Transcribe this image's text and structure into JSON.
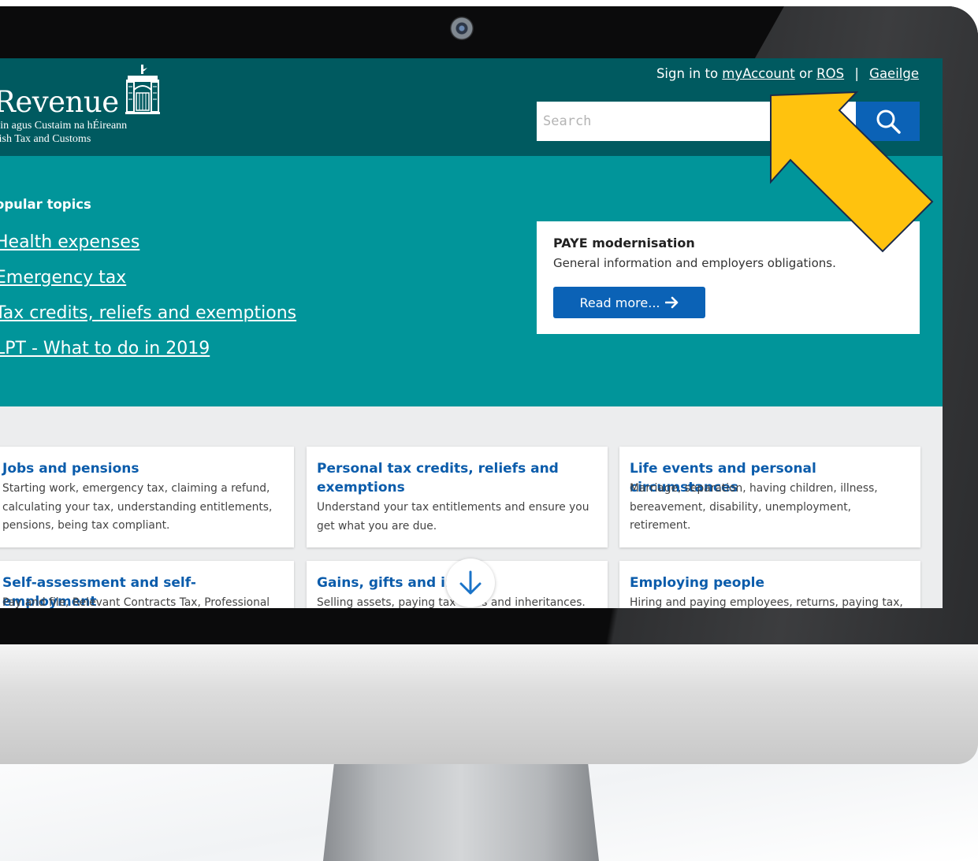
{
  "header": {
    "logo_word": "Revenue",
    "logo_line_1": "áin agus Custaim na hÉireann",
    "logo_line_2": "rish Tax and Customs",
    "sign_in_prefix": "Sign in to",
    "myaccount_link": "myAccount",
    "or_text": "or",
    "ros_link": "ROS",
    "separator": "|",
    "language_link": "Gaeilge",
    "search_placeholder": "Search"
  },
  "hero": {
    "popular_title": "opular topics",
    "popular_links": [
      "Health expenses",
      "Emergency tax",
      "Tax credits, reliefs and exemptions",
      "LPT - What to do in 2019"
    ],
    "promo": {
      "title": "PAYE modernisation",
      "description": "General information and employers obligations.",
      "button_label": "Read more..."
    }
  },
  "cards": [
    {
      "title": "Jobs and pensions",
      "description": "Starting work, emergency tax, claiming a refund, calculating your tax, understanding entitlements, pensions, being tax compliant."
    },
    {
      "title": "Personal tax credits, reliefs and exemptions",
      "description": "Understand your tax entitlements and ensure you get what you are due."
    },
    {
      "title": "Life events and personal circumstances",
      "description": "Marriage, separation, having children, illness, bereavement, disability, unemployment, retirement."
    },
    {
      "title": "Self-assessment and self-employment",
      "description": "Pay and file, Relevant Contracts Tax, Professional"
    },
    {
      "title": "Gains, gifts and inhe",
      "description": "Selling assets, paying tax o"
    },
    {
      "title": "Employing people",
      "description": "Hiring and paying employees, returns, paying tax,"
    }
  ],
  "card5_tail": "s and inheritances.",
  "icons": {
    "search": "search-icon",
    "read_more": "arrow-right-icon",
    "scroll": "arrow-down-icon",
    "annotation": "yellow-arrow-annotation"
  },
  "colors": {
    "header_bg": "#005a60",
    "hero_bg": "#01959a",
    "button_blue": "#0b62b6",
    "link_blue": "#0b5cab",
    "annotation_yellow": "#ffc20e"
  }
}
